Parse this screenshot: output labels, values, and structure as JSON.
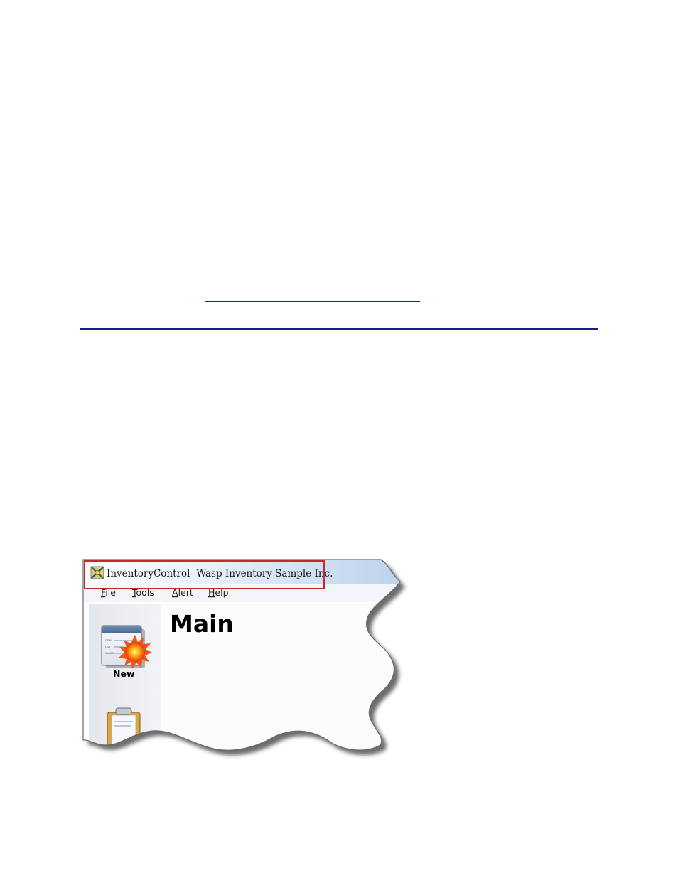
{
  "window": {
    "title": "InventoryControl- Wasp Inventory Sample Inc."
  },
  "menu": {
    "items": [
      {
        "label": "File",
        "mnemonic": "F",
        "rest": "ile"
      },
      {
        "label": "Tools",
        "mnemonic": "T",
        "rest": "ools"
      },
      {
        "label": "Alert",
        "mnemonic": "A",
        "rest": "lert"
      },
      {
        "label": "Help",
        "mnemonic": "H",
        "rest": "elp"
      }
    ]
  },
  "main": {
    "heading": "Main"
  },
  "sidebar": {
    "new_button_label": "New",
    "new_icon_lines": [
      "ITEM",
      "LIST",
      "CLASS"
    ]
  },
  "icons": {
    "app": "app-icon",
    "new": "new-document-icon",
    "clipboard": "clipboard-icon"
  },
  "colors": {
    "highlight_box": "#c8272d",
    "link_underline": "#1a1ad0",
    "rule": "#1c1c8c",
    "titlebar_left": "#ffffff",
    "titlebar_right": "#c3d6ee"
  }
}
